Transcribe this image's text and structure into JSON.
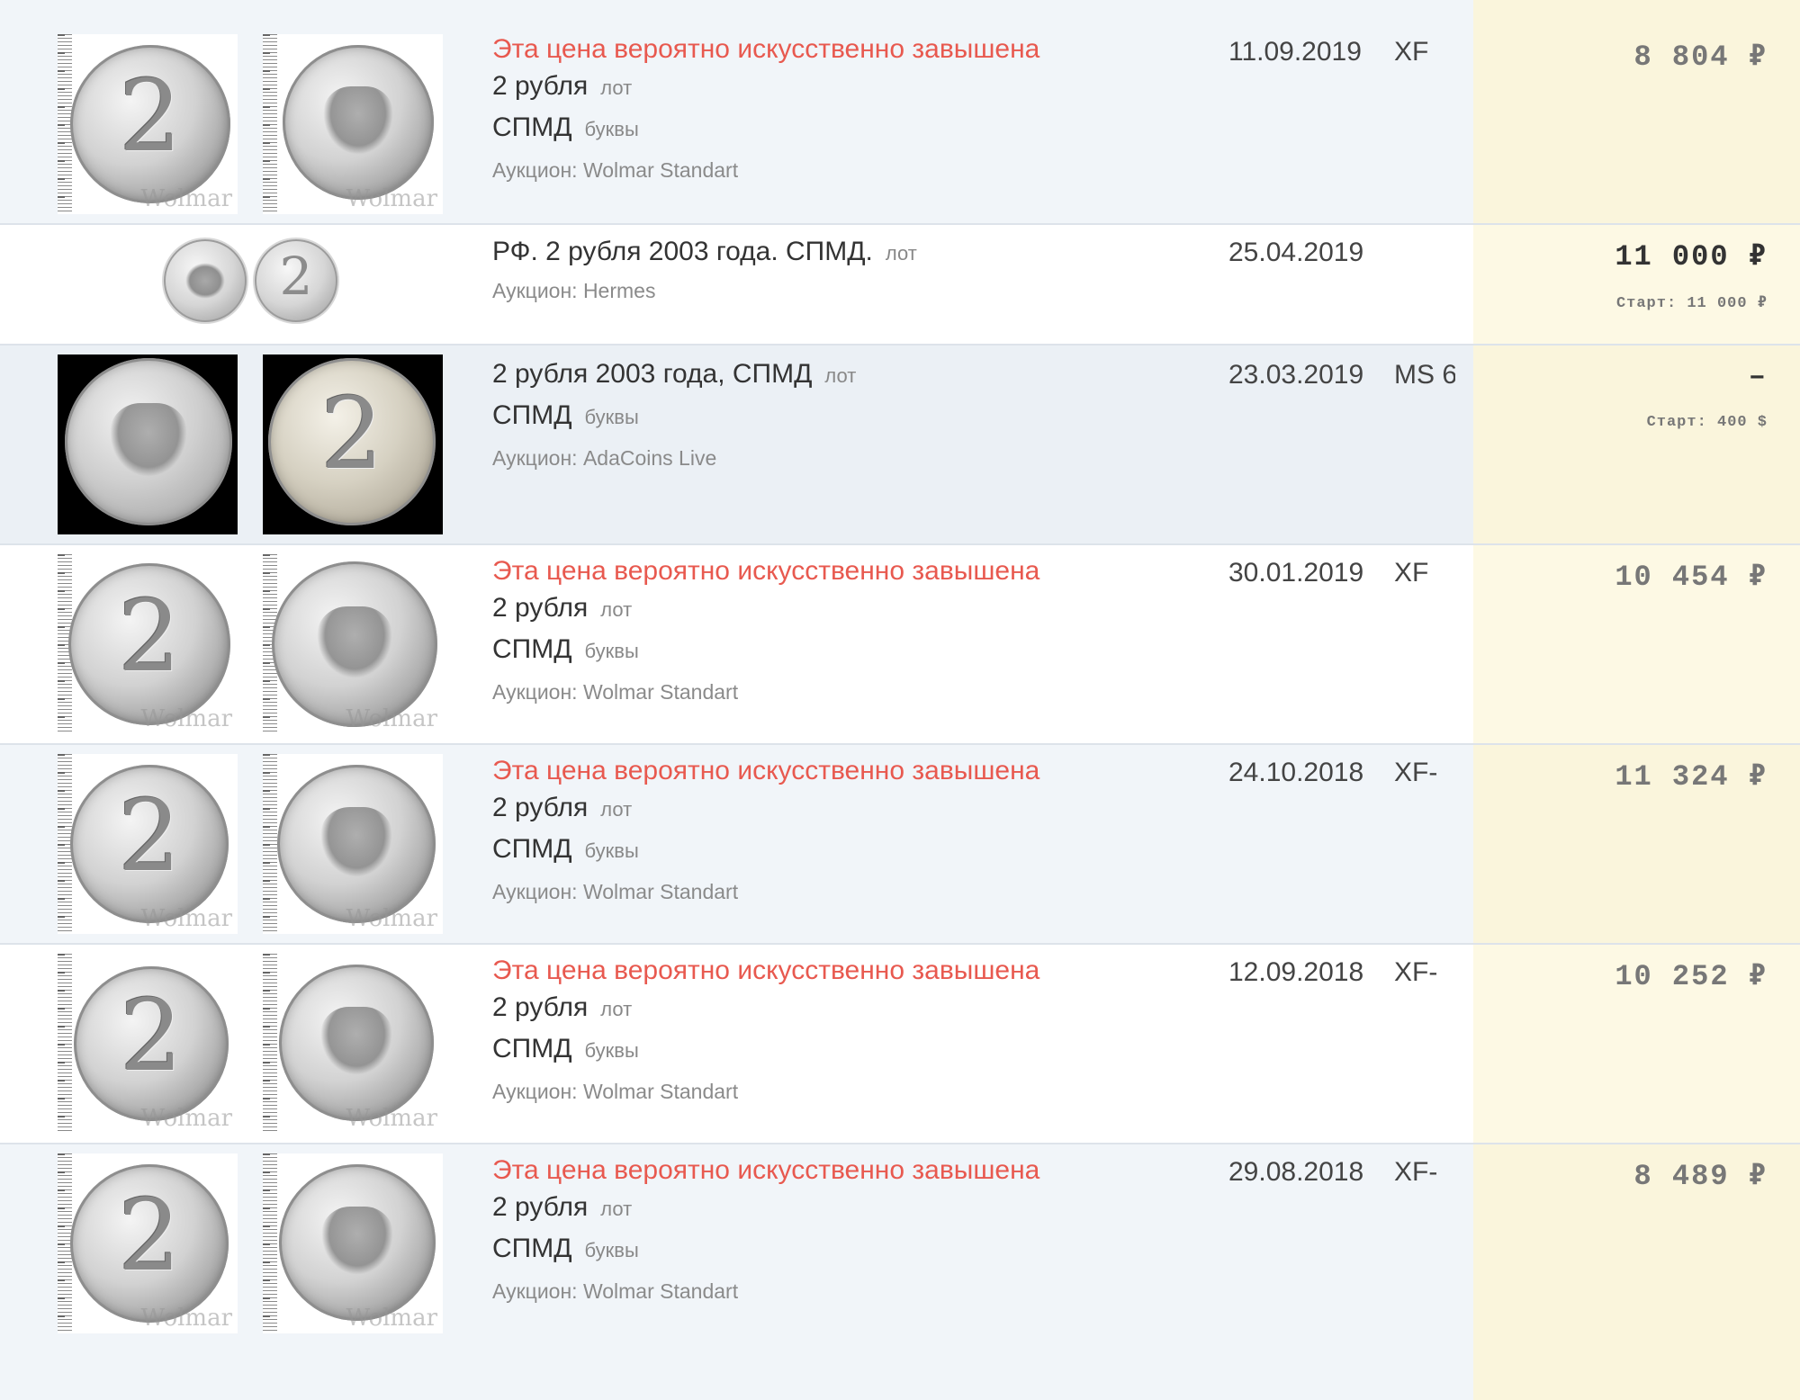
{
  "rows": [
    {
      "warning": "Эта цена вероятно искусственно завышена",
      "title": "2 рубля",
      "title_tag": "лот",
      "mint": "СПМД",
      "mint_tag": "буквы",
      "auction": "Аукцион: Wolmar Standart",
      "date": "11.09.2019",
      "grade": "XF",
      "price": "8 804 ₽",
      "watermark": "Wolmar"
    },
    {
      "title": "РФ. 2 рубля 2003 года. СПМД.",
      "title_tag": "лот",
      "auction": "Аукцион: Hermes",
      "date": "25.04.2019",
      "price": "11 000 ₽",
      "start": "Старт: 11 000 ₽"
    },
    {
      "title": "2 рубля 2003 года, СПМД",
      "title_tag": "лот",
      "mint": "СПМД",
      "mint_tag": "буквы",
      "auction": "Аукцион: AdaCoins Live",
      "date": "23.03.2019",
      "grade": "MS 6",
      "price": "–",
      "start": "Старт: 400 $"
    },
    {
      "warning": "Эта цена вероятно искусственно завышена",
      "title": "2 рубля",
      "title_tag": "лот",
      "mint": "СПМД",
      "mint_tag": "буквы",
      "auction": "Аукцион: Wolmar Standart",
      "date": "30.01.2019",
      "grade": "XF",
      "price": "10 454 ₽",
      "watermark": "Wolmar"
    },
    {
      "warning": "Эта цена вероятно искусственно завышена",
      "title": "2 рубля",
      "title_tag": "лот",
      "mint": "СПМД",
      "mint_tag": "буквы",
      "auction": "Аукцион: Wolmar Standart",
      "date": "24.10.2018",
      "grade": "XF-",
      "price": "11 324 ₽",
      "watermark": "Wolmar"
    },
    {
      "warning": "Эта цена вероятно искусственно завышена",
      "title": "2 рубля",
      "title_tag": "лот",
      "mint": "СПМД",
      "mint_tag": "буквы",
      "auction": "Аукцион: Wolmar Standart",
      "date": "12.09.2018",
      "grade": "XF-",
      "price": "10 252 ₽",
      "watermark": "Wolmar"
    },
    {
      "warning": "Эта цена вероятно искусственно завышена",
      "title": "2 рубля",
      "title_tag": "лот",
      "mint": "СПМД",
      "mint_tag": "буквы",
      "auction": "Аукцион: Wolmar Standart",
      "date": "29.08.2018",
      "grade": "XF-",
      "price": "8 489 ₽",
      "watermark": "Wolmar"
    }
  ],
  "coin_text": {
    "denomination_digit": "2"
  },
  "colors": {
    "warning": "#e8594f",
    "price_column_bg": "#fdf9e4",
    "row_alt_bg": "#f1f5f9"
  }
}
